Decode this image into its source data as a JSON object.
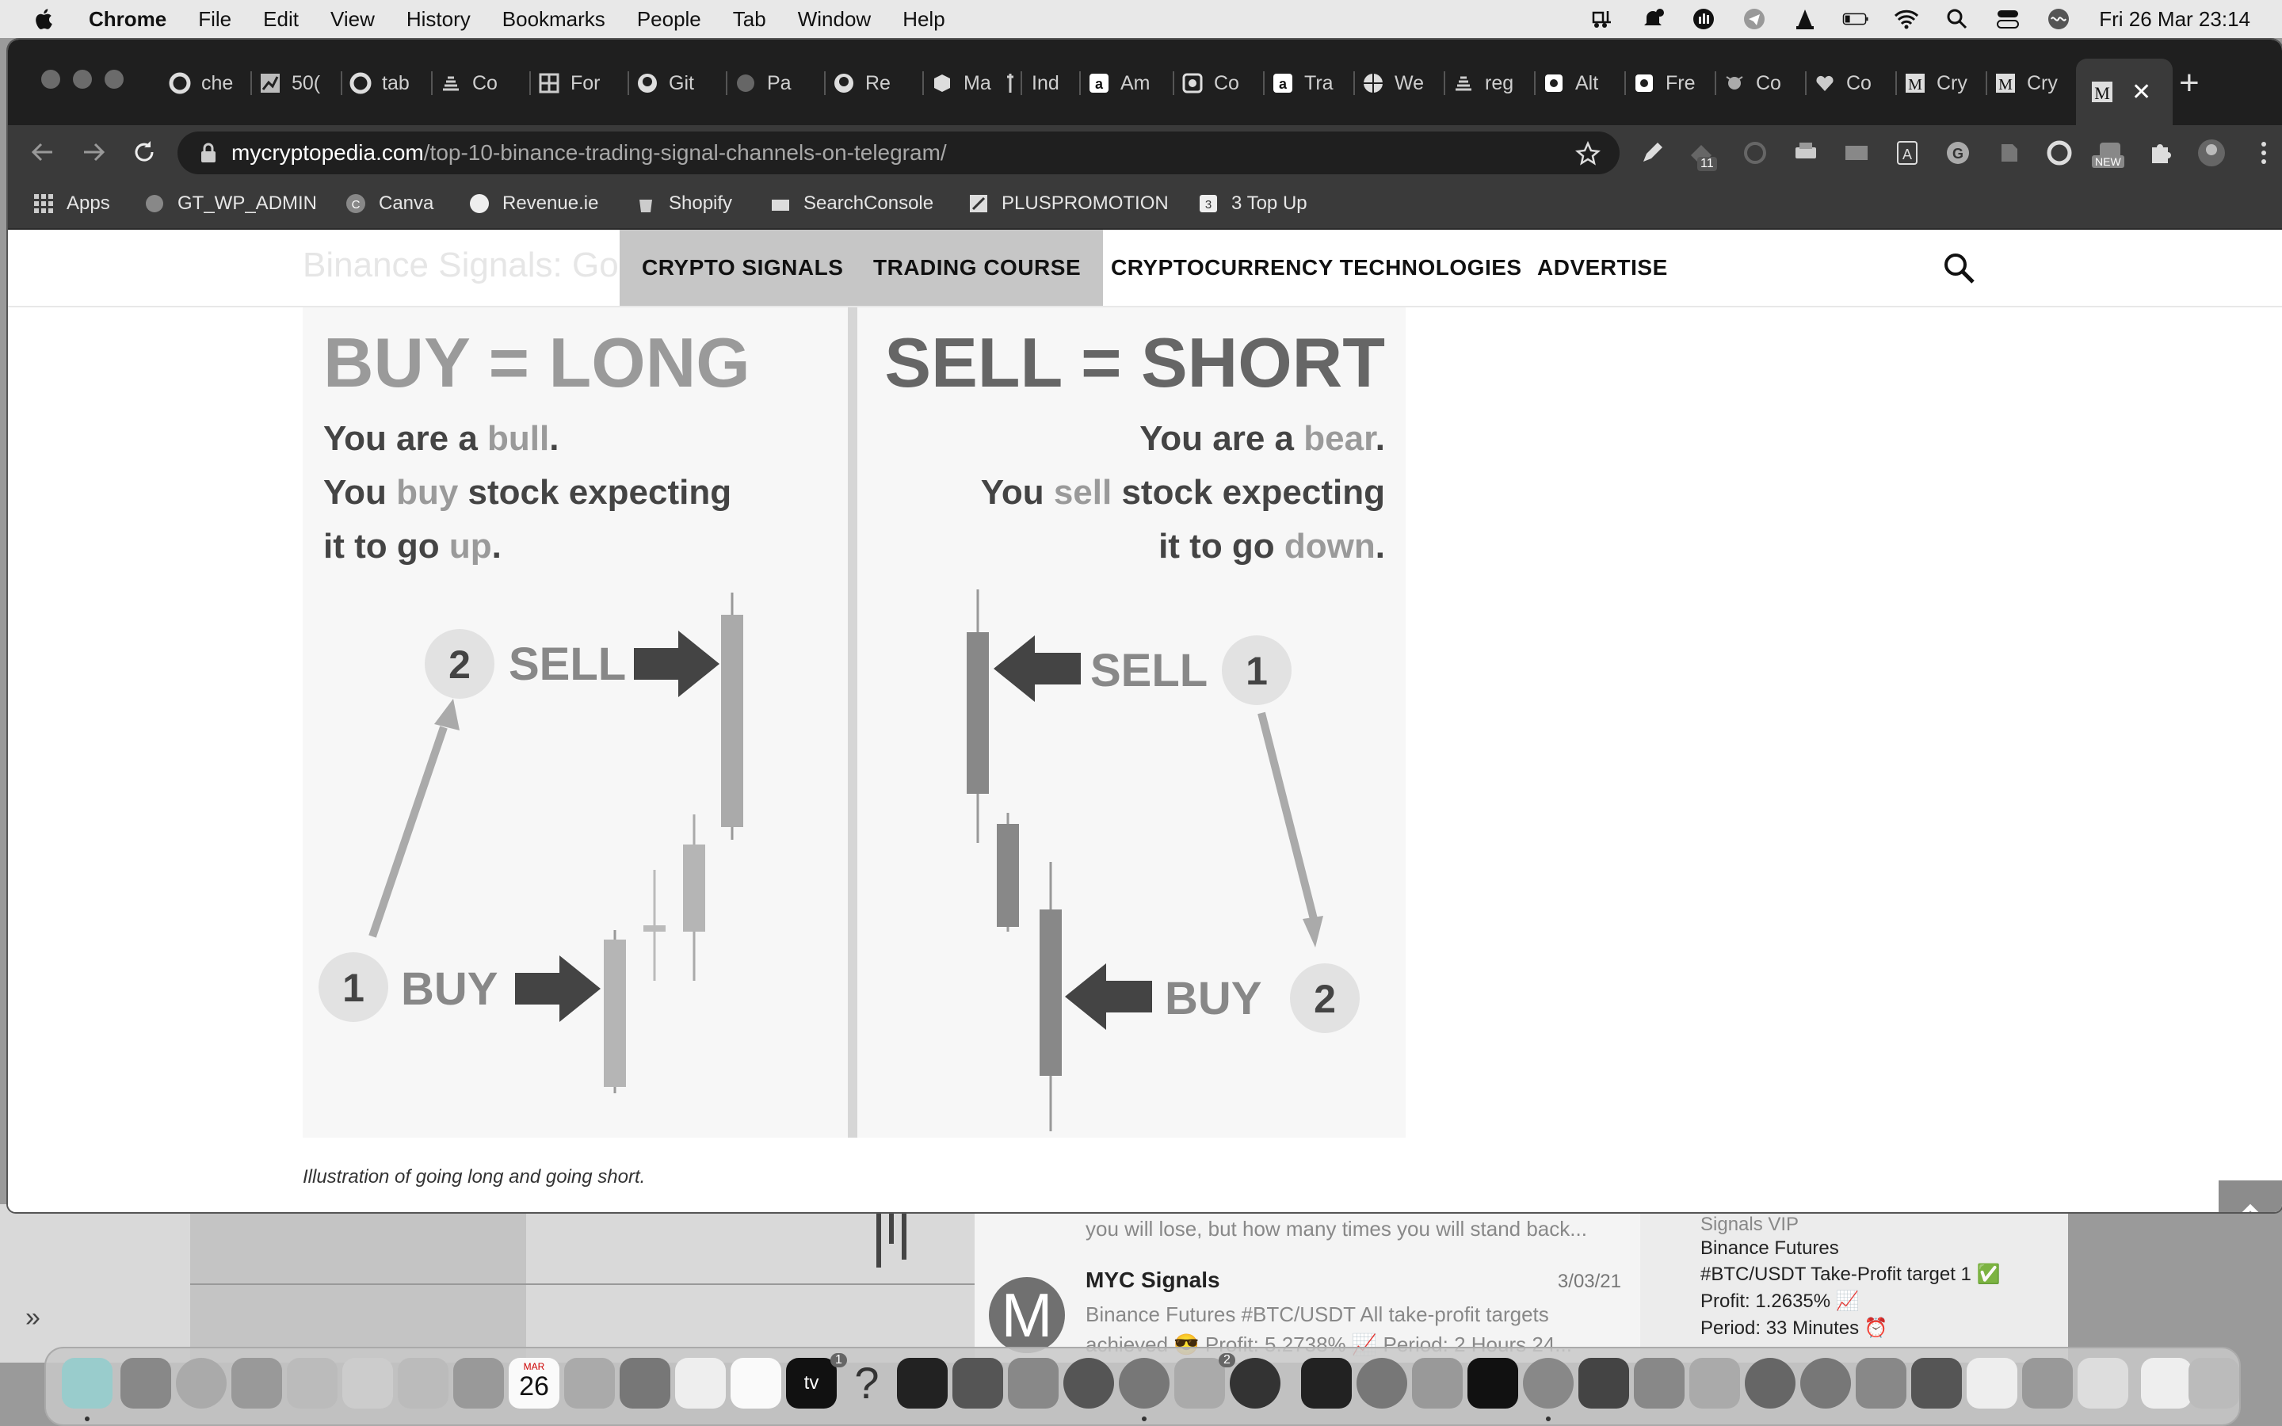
{
  "menubar": {
    "app_name": "Chrome",
    "items": [
      "File",
      "Edit",
      "View",
      "History",
      "Bookmarks",
      "People",
      "Tab",
      "Window",
      "Help"
    ],
    "clock": "Fri 26 Mar  23:14"
  },
  "browser": {
    "tabs": [
      {
        "label": "che",
        "icon": "google-icon"
      },
      {
        "label": "50(",
        "icon": "chart-icon"
      },
      {
        "label": "tab",
        "icon": "google-icon"
      },
      {
        "label": "Co",
        "icon": "stack-icon"
      },
      {
        "label": "For",
        "icon": "grid-icon"
      },
      {
        "label": "Git",
        "icon": "github-icon"
      },
      {
        "label": "Pa",
        "icon": "globe-icon"
      },
      {
        "label": "Re",
        "icon": "github-icon"
      },
      {
        "label": "Ma",
        "icon": "cube-icon"
      },
      {
        "label": "Ind",
        "icon": "pin-icon"
      },
      {
        "label": "Am",
        "icon": "amazon-icon"
      },
      {
        "label": "Co",
        "icon": "square-icon"
      },
      {
        "label": "Tra",
        "icon": "amazon-icon"
      },
      {
        "label": "We",
        "icon": "globe-icon"
      },
      {
        "label": "reg",
        "icon": "stack-icon"
      },
      {
        "label": "Alt",
        "icon": "square-icon"
      },
      {
        "label": "Fre",
        "icon": "square-icon"
      },
      {
        "label": "Co",
        "icon": "bug-icon"
      },
      {
        "label": "Co",
        "icon": "heart-icon"
      },
      {
        "label": "Cry",
        "icon": "m-icon"
      },
      {
        "label": "Cry",
        "icon": "m-icon"
      }
    ],
    "active_tab_icon_letter": "M",
    "url_host": "mycryptopedia.com",
    "url_path": "/top-10-binance-trading-signal-channels-on-telegram/",
    "extension_badge": "11",
    "extension_new_badge": "NEW",
    "bookmarks": [
      {
        "label": "Apps",
        "icon": "apps-grid-icon"
      },
      {
        "label": "GT_WP_ADMIN",
        "icon": "gt-icon"
      },
      {
        "label": "Canva",
        "icon": "canva-icon"
      },
      {
        "label": "Revenue.ie",
        "icon": "revenue-icon"
      },
      {
        "label": "Shopify",
        "icon": "shopify-icon"
      },
      {
        "label": "SearchConsole",
        "icon": "search-console-icon"
      },
      {
        "label": "PLUSPROMOTION",
        "icon": "plus-icon"
      },
      {
        "label": "3 Top Up",
        "icon": "topup-icon"
      }
    ]
  },
  "site": {
    "ghost_title": "Binance Signals: Go",
    "nav": [
      "CRYPTO SIGNALS",
      "TRADING COURSE",
      "CRYPTOCURRENCY TECHNOLOGIES",
      "ADVERTISE"
    ]
  },
  "illustration": {
    "left_title": "BUY = LONG",
    "left_l1_a": "You are a ",
    "left_l1_b": "bull",
    "left_l1_c": ".",
    "left_l2_a": "You ",
    "left_l2_b": "buy",
    "left_l2_c": " stock expecting",
    "left_l3_a": "it to go ",
    "left_l3_b": "up",
    "left_l3_c": ".",
    "right_title": "SELL = SHORT",
    "right_l1_a": "You are a ",
    "right_l1_b": "bear",
    "right_l1_c": ".",
    "right_l2_a": "You ",
    "right_l2_b": "sell",
    "right_l2_c": " stock expecting",
    "right_l3_a": "it to go ",
    "right_l3_b": "down",
    "right_l3_c": ".",
    "sell_label": "SELL",
    "buy_label": "BUY",
    "num_one": "1",
    "num_two": "2",
    "caption": "Illustration of going long and going short."
  },
  "telegram": {
    "prev_msg": "you will lose, but how many times you will stand back...",
    "chat_name": "MYC Signals",
    "chat_date": "3/03/21",
    "avatar_letter": "M",
    "chat_msg": "Binance Futures #BTC/USDT All take-profit targets achieved 😎 Profit: 5.2738% 📈 Period: 2 Hours 24...",
    "right_title": "Signals VIP",
    "right_l1": "Binance Futures",
    "right_l2": "#BTC/USDT Take-Profit target 1 ✅",
    "right_l3": "Profit: 1.2635% 📈",
    "right_l4": "Period: 33 Minutes ⏰"
  },
  "dock": {
    "calendar_month": "MAR",
    "calendar_day": "26",
    "tv_label": "tv",
    "help_glyph": "?",
    "badge_one": "1",
    "badge_two": "2"
  }
}
